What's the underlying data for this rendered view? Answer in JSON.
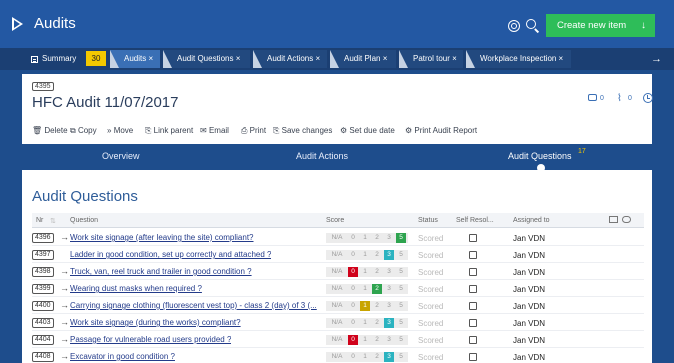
{
  "app": {
    "title": "Audits",
    "create_button": "Create new item",
    "create_arrow": "↓"
  },
  "tabs": {
    "summary": "Summary",
    "summary_badge": "30",
    "items": [
      {
        "label": "Audits ×"
      },
      {
        "label": "Audit Questions ×"
      },
      {
        "label": "Audit Actions ×"
      },
      {
        "label": "Audit Plan ×"
      },
      {
        "label": "Patrol tour ×"
      },
      {
        "label": "Workplace Inspection ×"
      }
    ],
    "next_arrow": "→"
  },
  "record": {
    "id": "4395",
    "title": "HFC Audit 11/07/2017",
    "comments_count": "0",
    "attachments_count": "0"
  },
  "actions": [
    "Delete",
    "Copy",
    "Move",
    "Link parent",
    "Email",
    "Print",
    "Save changes",
    "Set due date",
    "Print Audit Report"
  ],
  "action_glyphs": [
    "🗑",
    "⧉",
    "»",
    "⎘",
    "✉",
    "⎙",
    "⎘",
    "⚙",
    "⚙"
  ],
  "section_nav": {
    "overview": "Overview",
    "actions": "Audit Actions",
    "questions": "Audit Questions",
    "questions_count": "17"
  },
  "panel": {
    "title": "Audit Questions"
  },
  "columns": {
    "nr": "Nr",
    "question": "Question",
    "score": "Score",
    "status": "Status",
    "self_resolved": "Self Resol...",
    "assigned_to": "Assigned to"
  },
  "score_labels": [
    "N/A",
    "0",
    "1",
    "2",
    "3",
    "5"
  ],
  "score_colors": {
    "5": "#2ea44f",
    "3": "#2bb3c0",
    "0": "#d0021b",
    "1": "#c8a400",
    "2": "#2ea44f"
  },
  "rows": [
    {
      "nr": "4396",
      "arrow": "→",
      "question": "Work site signage (after leaving the site) compliant?",
      "score": "5",
      "status": "Scored",
      "assigned": "Jan VDN"
    },
    {
      "nr": "4397",
      "arrow": "",
      "question": "Ladder in good condition, set up correctly and attached ?",
      "score": "3",
      "status": "Scored",
      "assigned": "Jan VDN"
    },
    {
      "nr": "4398",
      "arrow": "→",
      "question": "Truck, van, reel truck and trailer in good condition ?",
      "score": "0",
      "status": "Scored",
      "assigned": "Jan VDN"
    },
    {
      "nr": "4399",
      "arrow": "→",
      "question": "Wearing dust masks when required ?",
      "score": "2",
      "status": "Scored",
      "assigned": "Jan VDN"
    },
    {
      "nr": "4400",
      "arrow": "→",
      "question": "Carrying signage clothing (fluorescent vest top) - class 2 (day) of 3 (...",
      "score": "1",
      "status": "Scored",
      "assigned": "Jan VDN"
    },
    {
      "nr": "4403",
      "arrow": "→",
      "question": "Work site signage (during the works) compliant?",
      "score": "3",
      "status": "Scored",
      "assigned": "Jan VDN"
    },
    {
      "nr": "4404",
      "arrow": "→",
      "question": "Passage for vulnerable road users provided ?",
      "score": "0",
      "status": "Scored",
      "assigned": "Jan VDN"
    },
    {
      "nr": "4408",
      "arrow": "→",
      "question": "Excavator in good condition ?",
      "score": "3",
      "status": "Scored",
      "assigned": "Jan VDN"
    }
  ]
}
